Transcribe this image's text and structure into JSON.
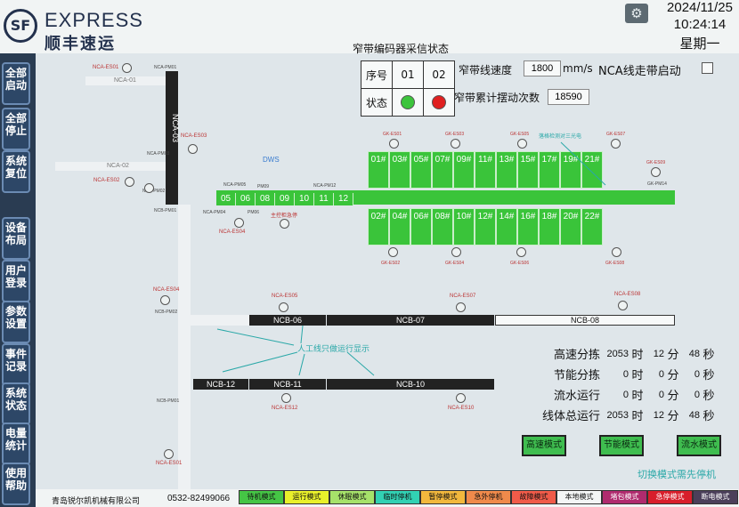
{
  "header": {
    "logo_mark": "SF",
    "logo_en": "EXPRESS",
    "logo_cn": "顺丰速运",
    "date": "2024/11/25",
    "time": "10:24:14",
    "weekday": "星期一",
    "gear_icon": "gear-icon"
  },
  "sidebar": {
    "buttons": [
      {
        "label": "全部启动"
      },
      {
        "label": "全部停止"
      },
      {
        "label": "系统复位"
      },
      {
        "label": "设备布局"
      },
      {
        "label": "用户登录"
      },
      {
        "label": "参数设置"
      },
      {
        "label": "事件记录"
      },
      {
        "label": "系统状态"
      },
      {
        "label": "电量统计"
      },
      {
        "label": "使用帮助"
      }
    ]
  },
  "main": {
    "title": "窄带编码器采信状态",
    "status_table": {
      "h1": "序号",
      "c1": "01",
      "c2": "02",
      "h2": "状态",
      "led1_color": "#3cc43c",
      "led2_color": "#e02020"
    },
    "speed_label": "窄带线速度",
    "speed_value": "1800",
    "speed_unit": "mm/s",
    "count_label": "窄带累计摆动次数",
    "count_value": "18590",
    "nca_label": "NCA线走带启动",
    "dws": "DWS",
    "belt_segments": [
      "05",
      "06",
      "08",
      "09",
      "10",
      "11",
      "12"
    ],
    "top_cells": [
      "01#",
      "03#",
      "05#",
      "07#",
      "09#",
      "11#",
      "13#",
      "15#",
      "17#",
      "19#",
      "21#"
    ],
    "bottom_cells": [
      "02#",
      "04#",
      "06#",
      "08#",
      "10#",
      "12#",
      "14#",
      "16#",
      "18#",
      "20#",
      "22#"
    ],
    "nca01": "NCA-01",
    "nca02": "NCA-02",
    "nca03": "NCA-03",
    "ncb_bars": {
      "ncb06": "NCB-06",
      "ncb07": "NCB-07",
      "ncb08": "NCB-08",
      "ncb12": "NCB-12",
      "ncb11": "NCB-11",
      "ncb10": "NCB-10"
    },
    "annotation": "人工线只做运行显示",
    "annotation2": "主控柜急停",
    "annotation3": "落格检测对三光电",
    "labels": {
      "ncaes01": "NCA-ES01",
      "ncapm01": "NCA-PM01",
      "ncaes03": "NCA-ES03",
      "ncapm03": "NCA-PM03",
      "ncaes02": "NCA-ES02",
      "ncapm02": "NCA-PM02",
      "ncapm05": "NCA-PM05",
      "pm09": "PM09",
      "pm12": "NCA-PM12",
      "ncbpm01": "NCB-PM01",
      "ncapm04": "NCA-PM04",
      "pm06": "PM06",
      "ncaes04": "NCA-ES04",
      "gkes01": "GK-ES01",
      "gkes03": "GK-ES03",
      "gkes05": "GK-ES05",
      "gkes07": "GK-ES07",
      "gkes09": "GK-ES09",
      "gkpm14": "GK-PM14",
      "gkes02": "GK-ES02",
      "gkes04": "GK-ES04",
      "gkes06": "GK-ES06",
      "gkes08": "GK-ES08",
      "ncaes04b": "NCA-ES04",
      "ncbpm02": "NCB-PM02",
      "ncaes05": "NCA-ES05",
      "ncaes07": "NCA-ES07",
      "ncaes08": "NCA-ES08",
      "ncbpm01b": "NCB-PM01",
      "ncaes12": "NCA-ES12",
      "ncaes10": "NCA-ES10",
      "ncaes01b": "NCA-ES01"
    },
    "stats": [
      {
        "label": "高速分拣",
        "hours": "2053",
        "h": "时",
        "minutes": "12",
        "m": "分",
        "seconds": "48",
        "s": "秒"
      },
      {
        "label": "节能分拣",
        "hours": "0",
        "h": "时",
        "minutes": "0",
        "m": "分",
        "seconds": "0",
        "s": "秒"
      },
      {
        "label": "流水运行",
        "hours": "0",
        "h": "时",
        "minutes": "0",
        "m": "分",
        "seconds": "0",
        "s": "秒"
      },
      {
        "label": "线体总运行",
        "hours": "2053",
        "h": "时",
        "minutes": "12",
        "m": "分",
        "seconds": "48",
        "s": "秒"
      }
    ],
    "mode_buttons": [
      "高速模式",
      "节能模式",
      "流水模式"
    ],
    "switch_hint": "切换模式需先停机"
  },
  "footer": {
    "company": "青岛锐尔凯机械有限公司",
    "phone": "0532-82499066",
    "modes": [
      {
        "label": "待机模式",
        "color": "#45c545"
      },
      {
        "label": "运行模式",
        "color": "#e9f02b"
      },
      {
        "label": "休眠模式",
        "color": "#a6e26a"
      },
      {
        "label": "临时停机",
        "color": "#32d1b3"
      },
      {
        "label": "暂停模式",
        "color": "#f2b83d"
      },
      {
        "label": "急外停机",
        "color": "#f08a4b"
      },
      {
        "label": "故障模式",
        "color": "#f05b49"
      },
      {
        "label": "本地模式",
        "color": "#f4f6f6"
      },
      {
        "label": "堵包模式",
        "color": "#b02b6e"
      },
      {
        "label": "急停模式",
        "color": "#d81e2b"
      },
      {
        "label": "断电模式",
        "color": "#4b3f5a"
      }
    ]
  }
}
